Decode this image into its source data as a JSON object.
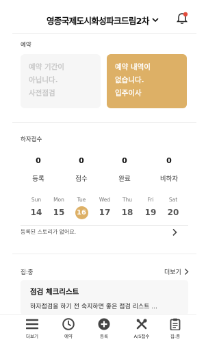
{
  "header": {
    "complex_name": "영종국제도시화성파크드림2차",
    "notification_dot_color": "#e34b3c"
  },
  "reservation": {
    "section_label": "예약",
    "left_card": {
      "line1": "예약 기간이",
      "line2": "아닙니다.",
      "line3": "사전점검"
    },
    "right_card": {
      "line1": "예약 내역이",
      "line2": "없습니다.",
      "line3": "입주이사"
    }
  },
  "defects": {
    "section_label": "하자접수",
    "stats": [
      {
        "value": "0",
        "label": "등록"
      },
      {
        "value": "0",
        "label": "접수"
      },
      {
        "value": "0",
        "label": "완료"
      },
      {
        "value": "0",
        "label": "비하자"
      }
    ]
  },
  "calendar": {
    "days": [
      {
        "name": "Sun",
        "date": "14"
      },
      {
        "name": "Mon",
        "date": "15"
      },
      {
        "name": "Tue",
        "date": "16"
      },
      {
        "name": "Wed",
        "date": "17"
      },
      {
        "name": "Thu",
        "date": "18"
      },
      {
        "name": "Fri",
        "date": "19"
      },
      {
        "name": "Sat",
        "date": "20"
      }
    ],
    "selected_date": "16",
    "story_text": "등록된 스토리가 없어요."
  },
  "jipjung": {
    "section_label": "집:중",
    "more_label": "더보기",
    "card_title": "점검 체크리스트",
    "card_desc": "하자점검을 하기 전 숙지하면 좋은 점검 리스트 ..."
  },
  "tabbar": [
    {
      "label": "더보기",
      "icon": "menu-icon"
    },
    {
      "label": "예약",
      "icon": "clock-icon"
    },
    {
      "label": "등록",
      "icon": "plus-circle-icon"
    },
    {
      "label": "A/S접수",
      "icon": "tools-icon"
    },
    {
      "label": "집:중",
      "icon": "clipboard-icon"
    }
  ],
  "colors": {
    "accent": "#ddb066",
    "icon": "#444444",
    "muted_card": "#f6f6f6"
  }
}
